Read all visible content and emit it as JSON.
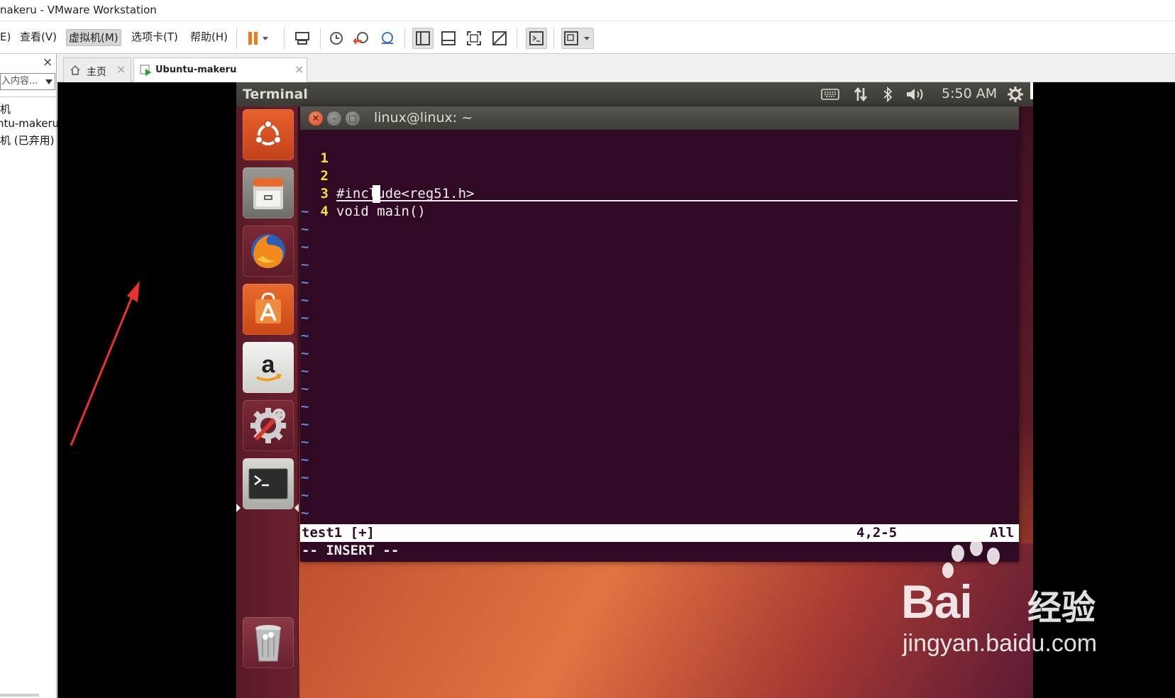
{
  "window": {
    "title": "nakeru - VMware Workstation"
  },
  "menubar": {
    "items": [
      {
        "label": "E)"
      },
      {
        "label": "查看(V)"
      },
      {
        "label": "虚拟机(M)"
      },
      {
        "label": "选项卡(T)"
      },
      {
        "label": "帮助(H)"
      }
    ],
    "active_index": 2,
    "toolbar_icons": [
      "pause-icon",
      "send-ctrl-alt-del-icon",
      "snapshot-take-icon",
      "snapshot-revert-icon",
      "snapshot-manager-icon",
      "show-library-icon",
      "show-thumbnail-bar-icon",
      "full-screen-icon",
      "unity-icon",
      "console-view-icon",
      "stretch-guest-icon"
    ]
  },
  "library": {
    "close_glyph": "×",
    "search_placeholder": "入内容...",
    "tree_items": [
      "机",
      "ntu-makeru",
      "机 (已弃用)"
    ]
  },
  "tabs": [
    {
      "label": "主页",
      "icon": "home-icon",
      "active": false
    },
    {
      "label": "Ubuntu-makeru",
      "icon": "vm-running-icon",
      "active": true
    }
  ],
  "guest": {
    "topbar": {
      "app_title": "Terminal",
      "time": "5:50 AM",
      "indicators": [
        "keyboard-icon",
        "network-icon",
        "bluetooth-icon",
        "volume-icon",
        "session-gear-icon"
      ]
    },
    "launcher": [
      "ubuntu-dash-icon",
      "files-icon",
      "firefox-icon",
      "software-center-icon",
      "amazon-icon",
      "system-settings-icon",
      "terminal-icon",
      "trash-icon"
    ],
    "terminal": {
      "title": "linux@linux: ~",
      "lines": [
        {
          "num": "1",
          "text": ""
        },
        {
          "num": "2",
          "text": "#include<reg51.h>"
        },
        {
          "num": "3",
          "text": "void main()"
        },
        {
          "num": "4",
          "text": ""
        }
      ],
      "tilde": "~",
      "tilde_count": 18,
      "status": {
        "file": "test1 [+]",
        "position": "4,2-5",
        "scroll": "All"
      },
      "mode": "-- INSERT --"
    }
  },
  "watermark": {
    "brand": "Bai",
    "brand_cn": "经验",
    "url": "jingyan.baidu.com"
  },
  "colors": {
    "terminal_bg": "#300a24",
    "line_number": "#f7e03a",
    "tilde": "#5e8bd8",
    "arrow": "#e8332c",
    "launcher_bg": "#6b2030"
  }
}
